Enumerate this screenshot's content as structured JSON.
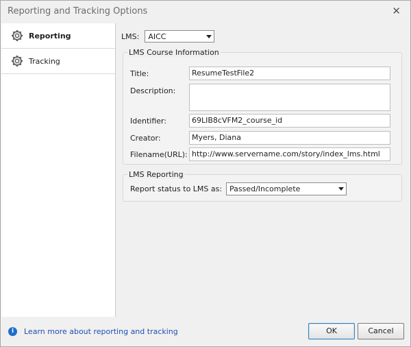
{
  "window": {
    "title": "Reporting and Tracking Options"
  },
  "sidebar": {
    "items": [
      {
        "label": "Reporting"
      },
      {
        "label": "Tracking"
      }
    ]
  },
  "lms": {
    "label": "LMS:",
    "value": "AICC"
  },
  "course_info": {
    "legend": "LMS Course Information",
    "fields": [
      {
        "label": "Title:",
        "value": "ResumeTestFile2"
      },
      {
        "label": "Description:",
        "value": ""
      },
      {
        "label": "Identifier:",
        "value": "69LIB8cVFM2_course_id"
      },
      {
        "label": "Creator:",
        "value": "Myers, Diana"
      },
      {
        "label": "Filename(URL):",
        "value": "http://www.servername.com/story/index_lms.html"
      }
    ]
  },
  "reporting": {
    "legend": "LMS Reporting",
    "status_label": "Report status to LMS as:",
    "status_value": "Passed/Incomplete"
  },
  "footer": {
    "help_text": "Learn more about reporting and tracking",
    "ok_label": "OK",
    "cancel_label": "Cancel"
  },
  "colors": {
    "link": "#1f4fb0",
    "info": "#1f6ec9"
  }
}
